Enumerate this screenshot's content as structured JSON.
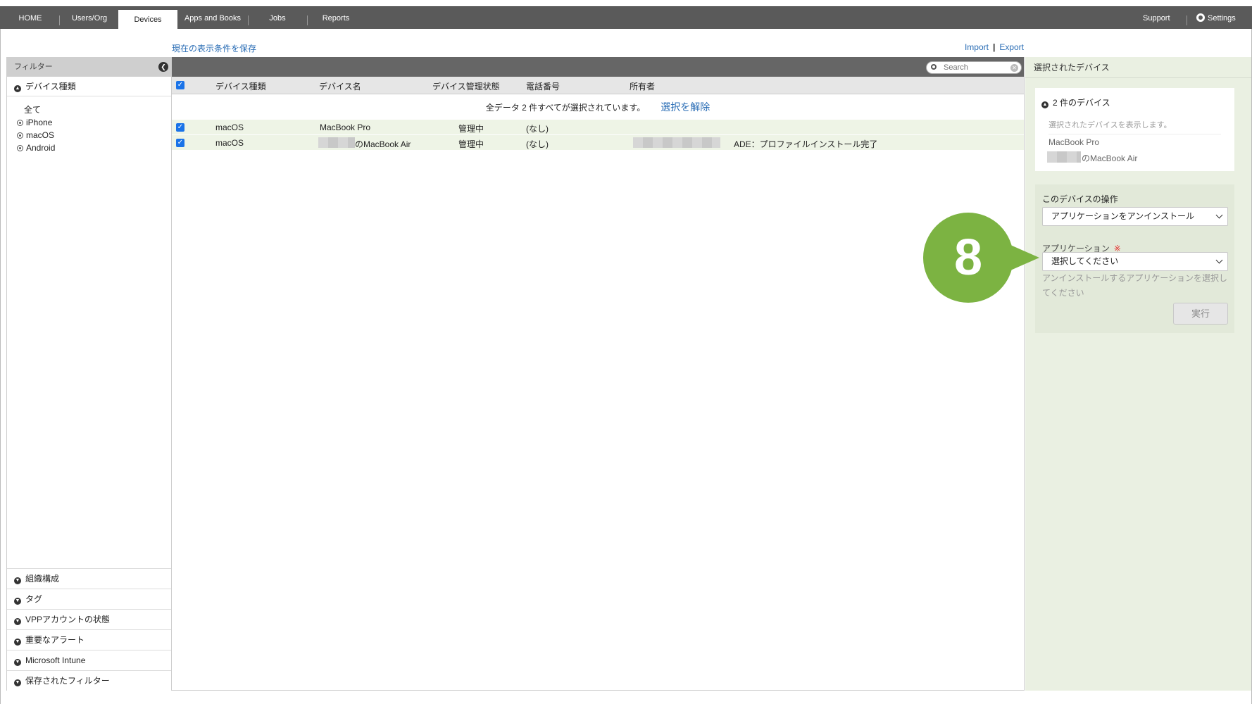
{
  "nav": {
    "tabs": [
      {
        "label": "HOME"
      },
      {
        "label": "Users/Org"
      },
      {
        "label": "Devices",
        "active": true
      },
      {
        "label": "Apps and Books"
      },
      {
        "label": "Jobs"
      },
      {
        "label": "Reports"
      }
    ],
    "support": "Support",
    "settings": "Settings"
  },
  "toolbar": {
    "save_view": "現在の表示条件を保存",
    "import": "Import",
    "export": "Export"
  },
  "filter": {
    "header": "フィルター",
    "device_type": "デバイス種類",
    "items": [
      "全て",
      "iPhone",
      "macOS",
      "Android"
    ],
    "bottom_sections": [
      "組織構成",
      "タグ",
      "VPPアカウントの状態",
      "重要なアラート",
      "Microsoft Intune",
      "保存されたフィルター"
    ]
  },
  "search": {
    "placeholder": "Search"
  },
  "table": {
    "columns": [
      "デバイス種類",
      "デバイス名",
      "デバイス管理状態",
      "電話番号",
      "所有者"
    ],
    "selection_message": "全データ 2 件すべてが選択されています。",
    "clear_selection": "選択を解除",
    "rows": [
      {
        "type": "macOS",
        "name": "MacBook Pro",
        "status": "管理中",
        "phone": "(なし)",
        "owner": "",
        "note": ""
      },
      {
        "type": "macOS",
        "name": "のMacBook Air",
        "status": "管理中",
        "phone": "(なし)",
        "owner": "",
        "note": "ADE：プロファイルインストール完了"
      }
    ]
  },
  "right_panel": {
    "header": "選択されたデバイス",
    "device_count": "2 件のデバイス",
    "hint": "選択されたデバイスを表示します。",
    "devices": [
      "MacBook Pro",
      "のMacBook Air"
    ],
    "operations_title": "このデバイスの操作",
    "operation_select": "アプリケーションをアンインストール",
    "application_label": "アプリケーション",
    "required_mark": "※",
    "application_select": "選択してください",
    "help_text": "アンインストールするアプリケーションを選択してください",
    "run_button": "実行"
  },
  "callout": {
    "number": "8",
    "color": "#7cb342"
  },
  "colors": {
    "nav_bg": "#5a5a5a",
    "link": "#2a6db5",
    "row_selected": "#eef4e6",
    "panel_bg": "#eaf0e2",
    "checkbox": "#1a73e8"
  }
}
